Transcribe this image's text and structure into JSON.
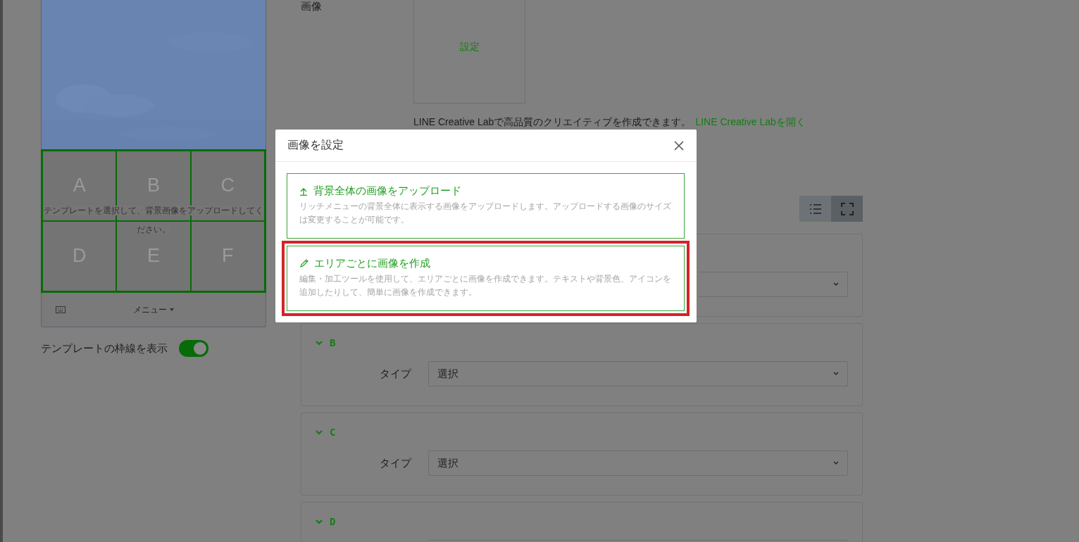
{
  "preview": {
    "cells": [
      "A",
      "B",
      "C",
      "D",
      "E",
      "F"
    ],
    "hint": "テンプレートを選択して、背景画像をアップロードしてください。",
    "menu_label": "メニュー"
  },
  "border_toggle": {
    "label": "テンプレートの枠線を表示",
    "on": true
  },
  "image_section": {
    "label": "画像",
    "button": "設定",
    "note": "LINE Creative Labで高品質のクリエイティブを作成できます。",
    "link": "LINE Creative Labを開く"
  },
  "view_buttons": [
    {
      "kind": "list",
      "selected": false
    },
    {
      "kind": "fullscreen",
      "selected": true
    }
  ],
  "areas": [
    {
      "kind": "covered"
    },
    {
      "kind": "full",
      "label": "B",
      "expanded": true,
      "type_label": "タイプ",
      "value": "選択"
    },
    {
      "kind": "full",
      "label": "C",
      "expanded": true,
      "type_label": "タイプ",
      "value": "選択"
    },
    {
      "kind": "header",
      "label": "D",
      "expanded": true
    }
  ],
  "dialog": {
    "title": "画像を設定",
    "options": [
      {
        "kind": "upload",
        "title": "背景全体の画像をアップロード",
        "description": "リッチメニューの背景全体に表示する画像をアップロードします。アップロードする画像のサイズは変更することが可能です。",
        "highlighted": false
      },
      {
        "kind": "edit",
        "title": "エリアごとに画像を作成",
        "description": "編集・加工ツールを使用して、エリアごとに画像を作成できます。テキストや背景色、アイコンを追加したりして、簡単に画像を作成できます。",
        "highlighted": true
      }
    ]
  }
}
